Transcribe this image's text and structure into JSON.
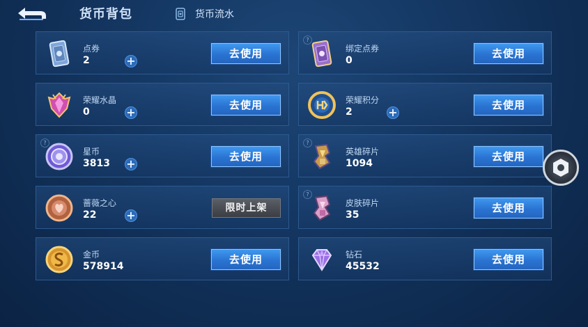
{
  "header": {
    "title": "货币背包",
    "flow_label": "货币流水"
  },
  "buttons": {
    "use_label": "去使用",
    "limited_label": "限时上架"
  },
  "left_column": [
    {
      "name": "点券",
      "amount": "2",
      "icon": "coupon-card-icon",
      "plus": true
    },
    {
      "name": "荣耀水晶",
      "amount": "0",
      "icon": "glory-crystal-icon",
      "plus": true
    },
    {
      "name": "星币",
      "amount": "3813",
      "icon": "star-coin-icon",
      "plus": true,
      "help": "?"
    },
    {
      "name": "蔷薇之心",
      "amount": "22",
      "icon": "rose-heart-icon",
      "plus": true
    },
    {
      "name": "金币",
      "amount": "578914",
      "icon": "gold-coin-icon",
      "plus": false
    }
  ],
  "right_column": [
    {
      "name": "绑定点券",
      "amount": "0",
      "icon": "bound-coupon-icon",
      "plus": false,
      "help": "?"
    },
    {
      "name": "荣耀积分",
      "amount": "2",
      "icon": "glory-points-icon",
      "plus": true
    },
    {
      "name": "英雄碎片",
      "amount": "1094",
      "icon": "hero-fragment-icon",
      "plus": false,
      "help": "?"
    },
    {
      "name": "皮肤碎片",
      "amount": "35",
      "icon": "skin-fragment-icon",
      "plus": false,
      "help": "?"
    },
    {
      "name": "钻石",
      "amount": "45532",
      "icon": "diamond-icon",
      "plus": false
    }
  ],
  "colors": {
    "accent_blue": "#2a73d2",
    "background": "#153965",
    "card_border": "#2d5a90"
  }
}
